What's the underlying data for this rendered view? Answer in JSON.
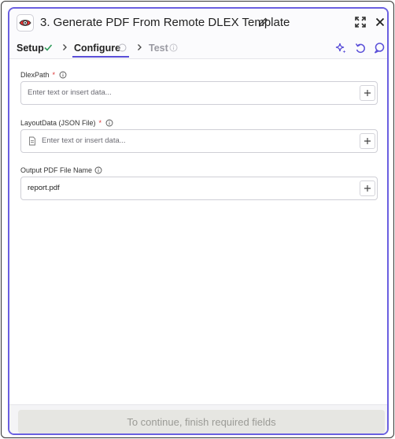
{
  "header": {
    "title": "3. Generate PDF From Remote DLEX Template",
    "app_icon": "eye-icon",
    "icons": [
      "pencil-icon",
      "expand-icon",
      "close-icon"
    ]
  },
  "tabs": [
    {
      "label": "Setup",
      "state": "completed",
      "icon": "check-icon"
    },
    {
      "label": "Configure",
      "state": "active",
      "icon": "info-icon"
    },
    {
      "label": "Test",
      "state": "disabled",
      "icon": "info-icon"
    }
  ],
  "toolbar_icons": [
    "sparkle-icon",
    "undo-icon",
    "comment-icon"
  ],
  "fields": [
    {
      "label": "DlexPath",
      "required": true,
      "required_mark": "*",
      "placeholder": "Enter text or insert data...",
      "value": "",
      "has_doc_icon": false
    },
    {
      "label": "LayoutData (JSON File)",
      "required": true,
      "required_mark": "*",
      "placeholder": "Enter text or insert data...",
      "value": "",
      "has_doc_icon": true
    },
    {
      "label": "Output PDF File Name",
      "required": false,
      "required_mark": "",
      "placeholder": "",
      "value": "report.pdf",
      "has_doc_icon": false
    }
  ],
  "footer": {
    "button_label": "To continue, finish required fields",
    "enabled": false
  },
  "colors": {
    "accent": "#5a4fd8",
    "border": "#6a5fe0",
    "success": "#2e9b5a",
    "required": "#d33333",
    "disabled_bg": "#e6e6e2"
  }
}
